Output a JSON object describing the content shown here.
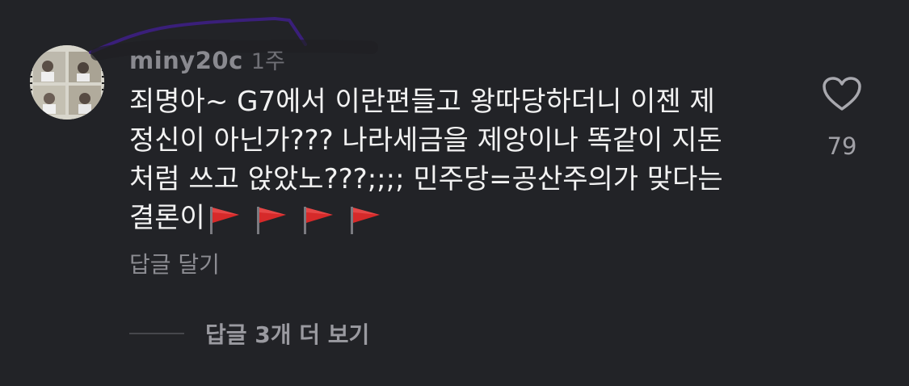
{
  "comment": {
    "username": "miny20c",
    "timestamp": "1주",
    "text_lines": [
      "죄명아~ G7에서 이란편들고 왕따당하더니 이젠 제",
      "정신이 아닌가??? 나라세금을 제앙이나 똑같이 지돈",
      "처럼 쓰고 앉았노???;;;; 민주당=공산주의가 맞다는",
      "결론이"
    ],
    "flag_count": 4,
    "like_count": "79",
    "reply_label": "답글 달기",
    "view_more_replies_label": "답글 3개 더 보기"
  },
  "icons": {
    "like": "heart-icon",
    "flag": "red-flag-icon"
  },
  "colors": {
    "background": "#222327",
    "text": "#f2f2f2",
    "muted": "#8c8c92",
    "flag": "#d62a2a",
    "scribble": "#3a1f7a"
  }
}
